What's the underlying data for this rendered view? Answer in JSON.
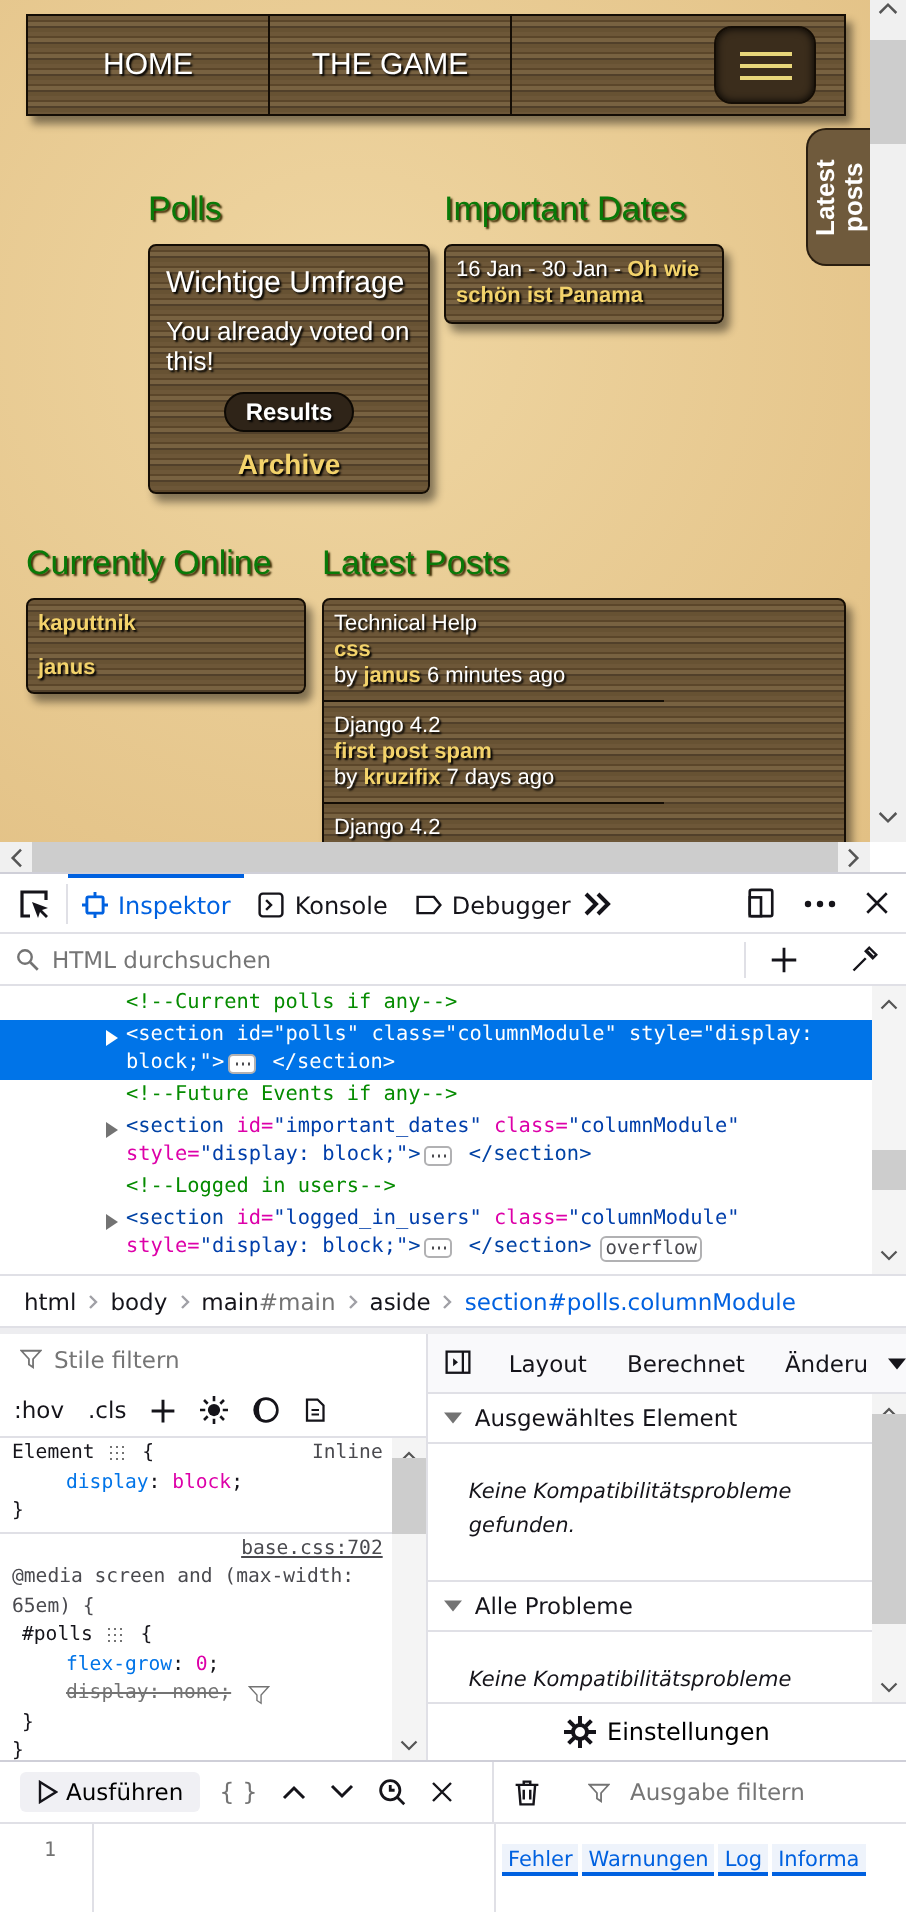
{
  "page": {
    "nav": {
      "items": [
        {
          "label": "HOME"
        },
        {
          "label": "THE GAME"
        }
      ]
    },
    "side_tab": "Latest posts",
    "polls": {
      "heading": "Polls",
      "title": "Wichtige Umfrage",
      "message": "You already voted on this!",
      "button": "Results",
      "link": "Archive"
    },
    "dates": {
      "heading": "Important Dates",
      "events": [
        "16 Jan - 30 Jan - **Oh wie schön ist Panama**"
      ]
    },
    "online": {
      "heading": "Currently Online",
      "users": [
        "kaputtnik",
        "janus"
      ]
    },
    "latest": {
      "heading": "Latest Posts",
      "posts": [
        {
          "forum": "Technical Help",
          "title": "css",
          "byline": "by **janus** 6 minutes ago"
        },
        {
          "forum": "Django 4.2",
          "title": "first post spam",
          "byline": "by **kruzifix** 7 days ago"
        },
        {
          "forum": "Django 4.2"
        }
      ]
    }
  },
  "devtools": {
    "tabs": [
      {
        "label": "Inspektor",
        "selected": true
      },
      {
        "label": "Konsole",
        "selected": false
      },
      {
        "label": "Debugger",
        "selected": false
      }
    ],
    "search": {
      "placeholder": "HTML durchsuchen"
    },
    "markup": [
      {
        "selected": false,
        "expandable": false,
        "lines": [
          [
            {
              "kind": "comment",
              "text": "<!--Current polls if any-->"
            }
          ]
        ]
      },
      {
        "selected": true,
        "expandable": true,
        "lines": [
          [
            {
              "kind": "tag",
              "text": "<section"
            },
            {
              "kind": "attr",
              "text": " id="
            },
            {
              "kind": "value",
              "text": "\"polls\""
            },
            {
              "kind": "attr",
              "text": " class="
            },
            {
              "kind": "value",
              "text": "\"columnModule\""
            },
            {
              "kind": "attr",
              "text": " style="
            },
            {
              "kind": "value",
              "text": "\"display:"
            }
          ],
          [
            {
              "kind": "value",
              "text": "block;\""
            },
            {
              "kind": "tag",
              "text": ">"
            },
            {
              "kind": "expander"
            },
            {
              "kind": "tag",
              "text": " </section>"
            }
          ]
        ]
      },
      {
        "selected": false,
        "expandable": false,
        "lines": [
          [
            {
              "kind": "comment",
              "text": "<!--Future Events if any-->"
            }
          ]
        ]
      },
      {
        "selected": false,
        "expandable": true,
        "lines": [
          [
            {
              "kind": "tag",
              "text": "<section"
            },
            {
              "kind": "attr",
              "text": " id="
            },
            {
              "kind": "value",
              "text": "\"important_dates\""
            },
            {
              "kind": "attr",
              "text": " class="
            },
            {
              "kind": "value",
              "text": "\"columnModule\""
            }
          ],
          [
            {
              "kind": "attr",
              "text": "style="
            },
            {
              "kind": "value",
              "text": "\"display: block;\""
            },
            {
              "kind": "tag",
              "text": ">"
            },
            {
              "kind": "expander"
            },
            {
              "kind": "tag",
              "text": " </section>"
            }
          ]
        ]
      },
      {
        "selected": false,
        "expandable": false,
        "lines": [
          [
            {
              "kind": "comment",
              "text": "<!--Logged in users-->"
            }
          ]
        ]
      },
      {
        "selected": false,
        "expandable": true,
        "lines": [
          [
            {
              "kind": "tag",
              "text": "<section"
            },
            {
              "kind": "attr",
              "text": " id="
            },
            {
              "kind": "value",
              "text": "\"logged_in_users\""
            },
            {
              "kind": "attr",
              "text": " class="
            },
            {
              "kind": "value",
              "text": "\"columnModule\""
            }
          ],
          [
            {
              "kind": "attr",
              "text": "style="
            },
            {
              "kind": "value",
              "text": "\"display: block;\""
            },
            {
              "kind": "tag",
              "text": ">"
            },
            {
              "kind": "expander"
            },
            {
              "kind": "tag",
              "text": " </section>"
            },
            {
              "kind": "badge",
              "text": "overflow"
            }
          ]
        ]
      }
    ],
    "breadcrumbs": [
      {
        "label": "html",
        "selected": false
      },
      {
        "label": "body",
        "selected": false
      },
      {
        "label": "main",
        "suffix": "#main",
        "selected": false
      },
      {
        "label": "aside",
        "selected": false
      },
      {
        "label": "section#polls.columnModule",
        "selected": true
      }
    ],
    "rules": {
      "filter_placeholder": "Stile filtern",
      "toggles": [
        ":hov",
        ".cls"
      ],
      "blocks": [
        {
          "lines": [
            {
              "kind": "top",
              "source": "Inline",
              "tokens": [
                {
                  "kind": "selector",
                  "text": "Element "
                },
                {
                  "kind": "grid"
                },
                {
                  "kind": "punct",
                  "text": " {"
                }
              ]
            },
            {
              "kind": "decl",
              "tokens": [
                {
                  "kind": "prop",
                  "text": "display"
                },
                {
                  "kind": "punct",
                  "text": ": "
                },
                {
                  "kind": "value",
                  "text": "block"
                },
                {
                  "kind": "punct",
                  "text": ";"
                }
              ]
            },
            {
              "kind": "top",
              "tokens": [
                {
                  "kind": "punct",
                  "text": "}"
                }
              ]
            }
          ]
        },
        {
          "lines": [
            {
              "kind": "top",
              "source": "base.css:702"
            },
            {
              "kind": "top",
              "tokens": [
                {
                  "kind": "media",
                  "text": "@media screen and (max-width: 65em) {"
                }
              ]
            },
            {
              "kind": "inner",
              "tokens": [
                {
                  "kind": "selector",
                  "text": "#polls "
                },
                {
                  "kind": "grid"
                },
                {
                  "kind": "punct",
                  "text": " {"
                }
              ]
            },
            {
              "kind": "decl",
              "tokens": [
                {
                  "kind": "prop",
                  "text": "flex-grow"
                },
                {
                  "kind": "punct",
                  "text": ": "
                },
                {
                  "kind": "value",
                  "text": "0"
                },
                {
                  "kind": "punct",
                  "text": ";"
                }
              ]
            },
            {
              "kind": "decl",
              "tokens": [
                {
                  "kind": "struck",
                  "text": "display: none;"
                },
                {
                  "kind": "filter"
                }
              ]
            },
            {
              "kind": "inner",
              "tokens": [
                {
                  "kind": "punct",
                  "text": "}"
                }
              ]
            },
            {
              "kind": "top",
              "tokens": [
                {
                  "kind": "punct",
                  "text": "}"
                }
              ]
            }
          ]
        }
      ]
    },
    "sidebar": {
      "tabs": [
        {
          "label": "Layout",
          "selected": false
        },
        {
          "label": "Berechnet",
          "selected": false
        },
        {
          "label": "Änderu",
          "selected": false
        }
      ],
      "sections": [
        {
          "title": "Ausgewähltes Element",
          "expanded": true,
          "message": "Keine Kompatibilitätsprobleme gefunden."
        },
        {
          "title": "Alle Probleme",
          "expanded": true,
          "message": "Keine Kompatibilitätsprobleme"
        }
      ],
      "settings": "Einstellungen"
    },
    "console": {
      "run": "Ausführen",
      "pretty_print": "{ }",
      "filter_placeholder": "Ausgabe filtern",
      "line_number": "1",
      "levels": [
        {
          "label": "Fehler",
          "on": true
        },
        {
          "label": "Warnungen",
          "on": true
        },
        {
          "label": "Log",
          "on": true
        },
        {
          "label": "Informa",
          "on": true
        }
      ]
    }
  }
}
